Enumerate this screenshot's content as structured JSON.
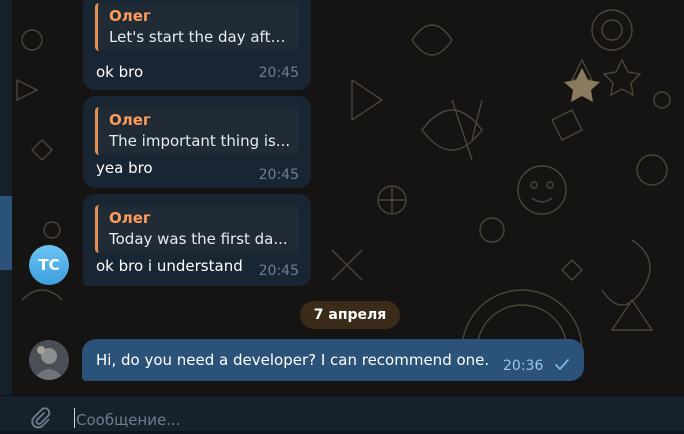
{
  "theme": {
    "incoming_bubble": "#182533",
    "outgoing_bubble": "#2b5278",
    "quote_author": "#ff9c5a",
    "quote_bar": "#e68d52",
    "date_pill": "#3b2c1a"
  },
  "messages": [
    {
      "reply_author": "Олег",
      "reply_text": "Let's start the day afte...",
      "text": "ok bro",
      "time": "20:45"
    },
    {
      "reply_author": "Олег",
      "reply_text": "The important thing is...",
      "text": "yea bro",
      "time": "20:45"
    },
    {
      "reply_author": "Олег",
      "reply_text": "Today was the first da...",
      "text": "ok bro i understand",
      "time": "20:45"
    }
  ],
  "sender_avatar": {
    "initials": "TC"
  },
  "date_separator": "7 апреля",
  "outgoing": {
    "text": "Hi, do you need a developer? I can recommend one.",
    "time": "20:36",
    "status_icon": "check-icon"
  },
  "composer": {
    "placeholder": "Сообщение...",
    "attach_icon": "paperclip-icon"
  }
}
